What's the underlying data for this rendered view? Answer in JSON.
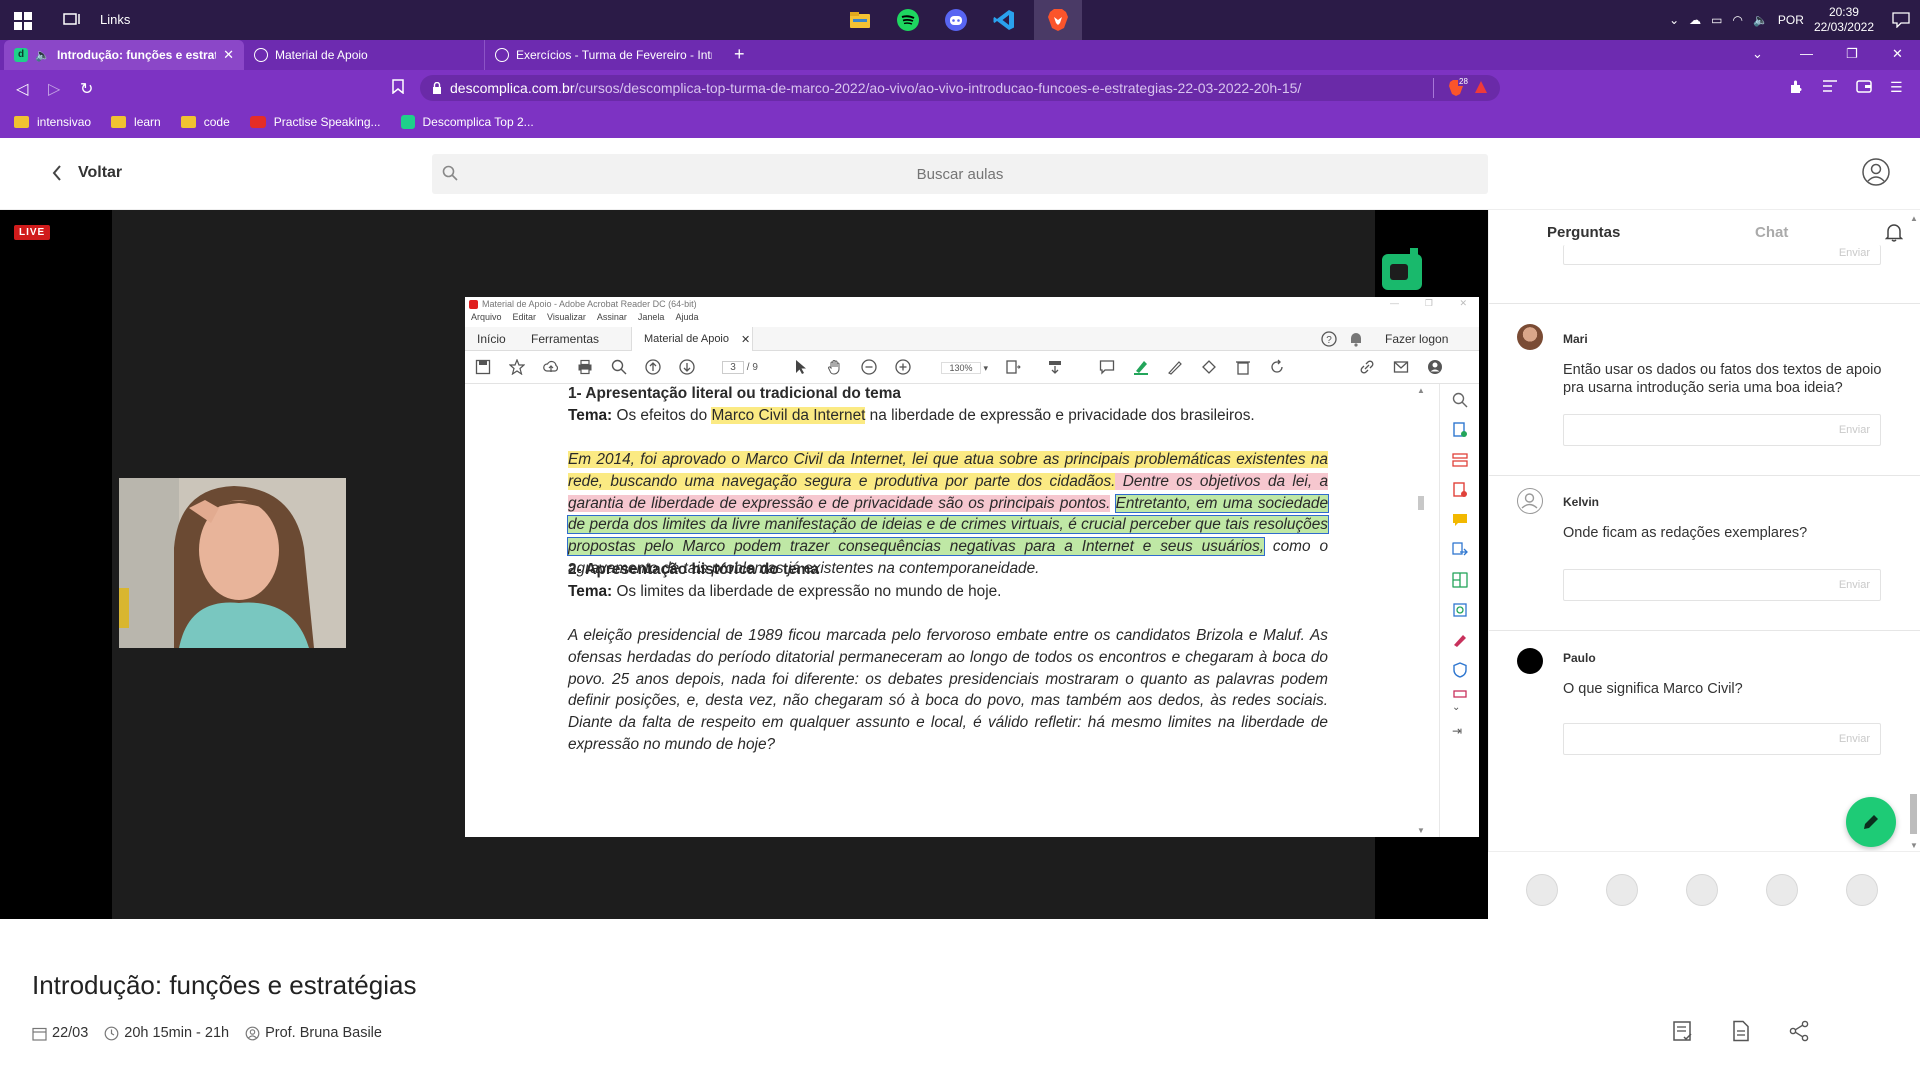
{
  "taskbar": {
    "links_label": "Links",
    "tray": {
      "language": "POR",
      "time": "20:39",
      "date": "22/03/2022"
    }
  },
  "browser": {
    "tabs": [
      {
        "title": "Introdução: funções e estratég",
        "active": true
      },
      {
        "title": "Material de Apoio",
        "active": false
      },
      {
        "title": "Exercícios - Turma de Fevereiro - Intro",
        "active": false
      }
    ],
    "url": {
      "domain": "descomplica.com.br",
      "path": "/cursos/descomplica-top-turma-de-marco-2022/ao-vivo/ao-vivo-introducao-funcoes-e-estrategias-22-03-2022-20h-15/"
    },
    "shield_count": "28",
    "bookmarks": [
      {
        "label": "intensivao",
        "type": "folder"
      },
      {
        "label": "learn",
        "type": "folder"
      },
      {
        "label": "code",
        "type": "folder"
      },
      {
        "label": "Practise Speaking...",
        "type": "youtube"
      },
      {
        "label": "Descomplica Top 2...",
        "type": "descomplica"
      }
    ]
  },
  "site": {
    "back_label": "Voltar",
    "search_placeholder": "Buscar aulas"
  },
  "video": {
    "live_badge": "LIVE",
    "brand_glyph": "d"
  },
  "acrobat": {
    "window_title": "Material de Apoio - Adobe Acrobat Reader DC (64-bit)",
    "menu": [
      "Arquivo",
      "Editar",
      "Visualizar",
      "Assinar",
      "Janela",
      "Ajuda"
    ],
    "tabs": {
      "home": "Início",
      "tools": "Ferramentas",
      "doc": "Material de Apoio",
      "login": "Fazer logon"
    },
    "page": {
      "current": "3",
      "total": "/ 9"
    },
    "zoom": "130%",
    "content": {
      "h1": "1- Apresentação literal ou tradicional do tema",
      "tema1_label": "Tema:",
      "tema1_pre": "Os efeitos do ",
      "tema1_hl": "Marco Civil da Internet",
      "tema1_post": " na liberdade de expressão e privacidade dos brasileiros.",
      "p1_yellow": "Em 2014, foi aprovado o Marco Civil da Internet, lei que atua sobre as principais problemáticas existentes na rede, buscando uma navegação segura e produtiva por parte dos cidadãos.",
      "p1_pink": " Dentre os objetivos da lei, a garantia de liberdade de expressão e de privacidade são os principais pontos.",
      "p1_green": "Entretanto, em uma sociedade de perda dos limites da livre manifestação de ideias e de crimes virtuais, é crucial perceber que tais resoluções propostas pelo Marco podem trazer consequências negativas para a Internet e seus usuários,",
      "p1_rest": " como o agravamento de tais problemas já existentes na contemporaneidade.",
      "h2": "2- Apresentação histórica do tema",
      "tema2_label": "Tema:",
      "tema2_text": " Os limites da liberdade de expressão no mundo de hoje.",
      "p2": "A eleição presidencial de 1989 ficou marcada pelo fervoroso embate entre os candidatos Brizola e Maluf. As ofensas herdadas do período ditatorial permaneceram ao longo de todos os encontros e chegaram à boca do povo. 25 anos depois, nada foi diferente: os debates presidenciais mostraram o quanto as palavras podem definir posições, e, desta vez, não chegaram só à boca do povo, mas também aos dedos, às redes sociais. Diante da falta de respeito em qualquer assunto e local, é válido refletir: há mesmo limites na liberdade de expressão no mundo de hoje?"
    }
  },
  "panel": {
    "tabs": {
      "questions": "Perguntas",
      "chat": "Chat"
    },
    "send_label": "Enviar",
    "questions": [
      {
        "name": "Mari",
        "text": "Então usar os dados ou fatos dos textos de apoio pra usarna introdução seria uma boa ideia?"
      },
      {
        "name": "Kelvin",
        "text": "Onde ficam as redações exemplares?"
      },
      {
        "name": "Paulo",
        "text": "O que significa Marco Civil?"
      }
    ]
  },
  "lesson": {
    "title": "Introdução: funções e estratégias",
    "date": "22/03",
    "time": "20h 15min - 21h",
    "teacher": "Prof. Bruna Basile"
  },
  "colors": {
    "taskbar": "#2b1b47",
    "browser_tabs": "#6d2bb0",
    "browser_toolbar": "#7d33c3",
    "brand_green": "#1ecb76",
    "live_red": "#d01b1b"
  }
}
